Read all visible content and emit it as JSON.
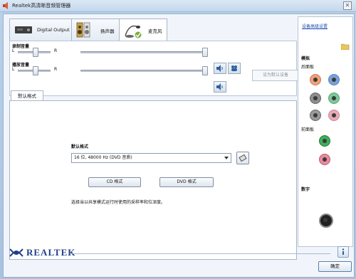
{
  "window": {
    "title": "Realtek高清晰音频管理器",
    "close_glyph": "✕"
  },
  "tabs": [
    {
      "label": "Digital Output"
    },
    {
      "label": "扬声器"
    },
    {
      "label": "麦克风"
    }
  ],
  "recording_volume": {
    "label": "录制音量",
    "left": "L",
    "right": "R"
  },
  "playback_volume": {
    "label": "播放音量",
    "left": "L",
    "right": "R"
  },
  "set_default_button": "设为默认设备",
  "subtab": {
    "label": "默认格式"
  },
  "default_format": {
    "label": "默认格式",
    "selected": "16 位, 48000 Hz (DVD 音质)",
    "cd_button": "CD 格式",
    "dvd_button": "DVD 格式",
    "description": "选择当以共享模式运行时使用的采样率和位深度。"
  },
  "sidebar": {
    "advanced_link": "设备高级设置",
    "analog_label": "模拟",
    "rear_panel_label": "后面板",
    "front_panel_label": "前面板",
    "digital_label": "数字"
  },
  "footer": {
    "brand": "REALTEK",
    "ok_button": "确定"
  },
  "colors": {
    "accent": "#1f3f86",
    "link": "#1b4fb0"
  }
}
